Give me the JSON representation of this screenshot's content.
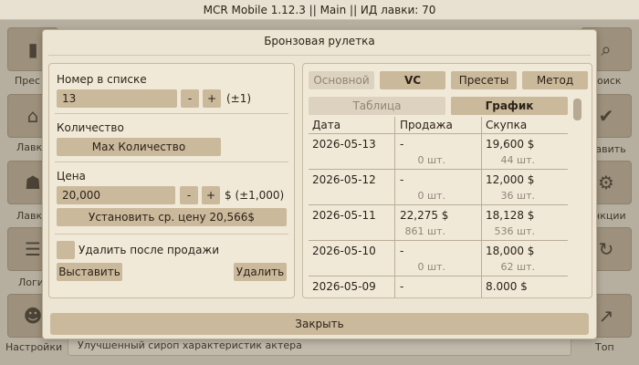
{
  "window": {
    "title": "MCR Mobile 1.12.3 || Main || ИД лавки: 70"
  },
  "background": {
    "left_labels": [
      "Прес",
      "Лавк",
      "Лавк",
      "Логи",
      "Настройки"
    ],
    "right_labels": [
      "оиск",
      "тавить",
      "нкции",
      "",
      "Топ"
    ],
    "footer_text": "Улучшенный сироп характеристик актера"
  },
  "modal": {
    "title": "Бронзовая рулетка",
    "close_label": "Закрыть"
  },
  "left": {
    "list_number_label": "Номер в списке",
    "list_number_value": "13",
    "minus": "-",
    "plus": "+",
    "list_step": "(±1)",
    "quantity_label": "Количество",
    "max_quantity_button": "Max Количество",
    "price_label": "Цена",
    "price_value": "20,000",
    "price_suffix": "$ (±1,000)",
    "set_avg_price_button": "Установить ср. цену 20,566$",
    "delete_after_sale_label": "Удалить после продажи",
    "place_button": "Выставить",
    "delete_button": "Удалить"
  },
  "right": {
    "tabs": [
      "Основной",
      "VC",
      "Пресеты",
      "Метод"
    ],
    "subtabs": [
      "Таблица",
      "График"
    ],
    "columns": [
      "Дата",
      "Продажа",
      "Скупка"
    ],
    "rows": [
      {
        "date": "2026-05-13",
        "sell": "-",
        "sell_qty": "0 шт.",
        "buy": "19,600 $",
        "buy_qty": "44 шт."
      },
      {
        "date": "2026-05-12",
        "sell": "-",
        "sell_qty": "0 шт.",
        "buy": "12,000 $",
        "buy_qty": "36 шт."
      },
      {
        "date": "2026-05-11",
        "sell": "22,275 $",
        "sell_qty": "861 шт.",
        "buy": "18,128 $",
        "buy_qty": "536 шт."
      },
      {
        "date": "2026-05-10",
        "sell": "-",
        "sell_qty": "0 шт.",
        "buy": "18,000 $",
        "buy_qty": "62 шт."
      },
      {
        "date": "2026-05-09",
        "sell": "-",
        "sell_qty": "",
        "buy": "8,000 $",
        "buy_qty": ""
      }
    ]
  }
}
